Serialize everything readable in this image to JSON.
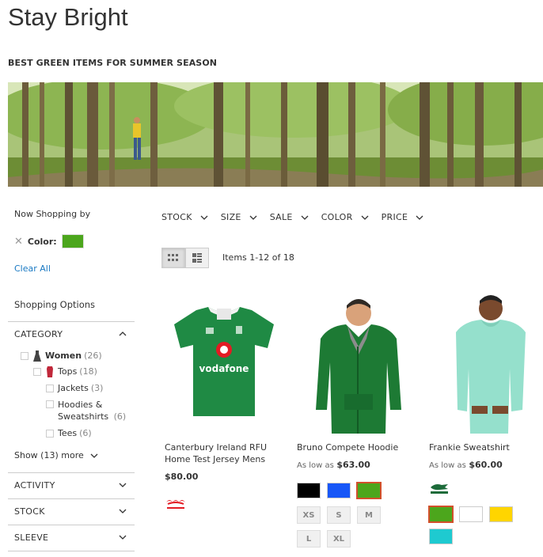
{
  "page": {
    "title": "Stay Bright",
    "subtitle": "BEST GREEN ITEMS FOR SUMMER SEASON"
  },
  "sidebar": {
    "now_shopping": "Now Shopping by",
    "active_filter": {
      "label": "Color:",
      "swatch_color": "#4ca61c",
      "remove_icon": "close-icon"
    },
    "clear_all": "Clear All",
    "shopping_options": "Shopping Options",
    "category": {
      "title": "CATEGORY",
      "items": [
        {
          "label": "Women",
          "count": "(26)",
          "level": 0,
          "icon": "dress-icon"
        },
        {
          "label": "Tops",
          "count": "(18)",
          "level": 1,
          "icon": "top-icon"
        },
        {
          "label": "Jackets",
          "count": "(3)",
          "level": 2
        },
        {
          "label": "Hoodies &",
          "label2": "Sweatshirts",
          "count": "(6)",
          "level": 2
        },
        {
          "label": "Tees",
          "count": "(6)",
          "level": 2
        }
      ],
      "show_more_prefix": "Show ( ",
      "show_more_count": "13",
      "show_more_suffix": " ) more"
    },
    "sections": [
      "ACTIVITY",
      "STOCK",
      "SLEEVE"
    ]
  },
  "toolbar": {
    "filters": [
      "STOCK",
      "SIZE",
      "SALE",
      "COLOR",
      "PRICE"
    ],
    "items_count": "Items 1-12 of 18",
    "view_modes": [
      "grid",
      "list"
    ]
  },
  "products": [
    {
      "name": "Canterbury Ireland RFU Home Test Jersey Mens",
      "price_label": "",
      "price": "$80.00",
      "brand": "canterbury-logo"
    },
    {
      "name": "Bruno Compete Hoodie",
      "price_label": "As low as",
      "price": "$63.00",
      "swatches": [
        "#000000",
        "#1857f7",
        "#4ca61c"
      ],
      "selected_swatch": 2,
      "sizes": [
        "XS",
        "S",
        "M",
        "L",
        "XL"
      ]
    },
    {
      "name": "Frankie Sweatshirt",
      "price_label": "As low as",
      "price": "$60.00",
      "brand": "lacoste-logo",
      "swatches": [
        "#4ca61c",
        "#ffffff",
        "#ffd500",
        "#1ecad0"
      ],
      "selected_swatch": 0
    }
  ],
  "colors": {
    "link": "#1979c3",
    "accent_outline": "#d2502b"
  }
}
